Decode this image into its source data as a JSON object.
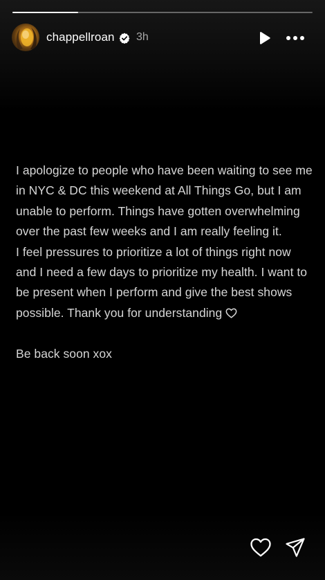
{
  "story": {
    "progress_fraction": 0.22,
    "progress_color": "#ffffff",
    "track_color": "rgba(255,255,255,0.35)"
  },
  "header": {
    "username": "chappellroan",
    "verified_icon": "verified-badge-icon",
    "timestamp": "3h",
    "play_icon": "play-icon",
    "more_icon": "more-horizontal-icon"
  },
  "content": {
    "line_1": "I apologize to people who have been waiting to see me in NYC & DC this weekend at All Things Go, but I am unable to perform. Things have gotten overwhelming over the past few weeks and I am really feeling it.",
    "line_2": "I feel pressures to prioritize a lot of things right now and I need a few days to prioritize my health. I want to be present when I perform and give the best shows possible. Thank you for understanding",
    "heart_icon": "heart-outline-icon",
    "line_3": "Be back soon xox",
    "text_color": "#d6d6d6"
  },
  "footer": {
    "like_icon": "heart-icon",
    "share_icon": "send-icon"
  }
}
